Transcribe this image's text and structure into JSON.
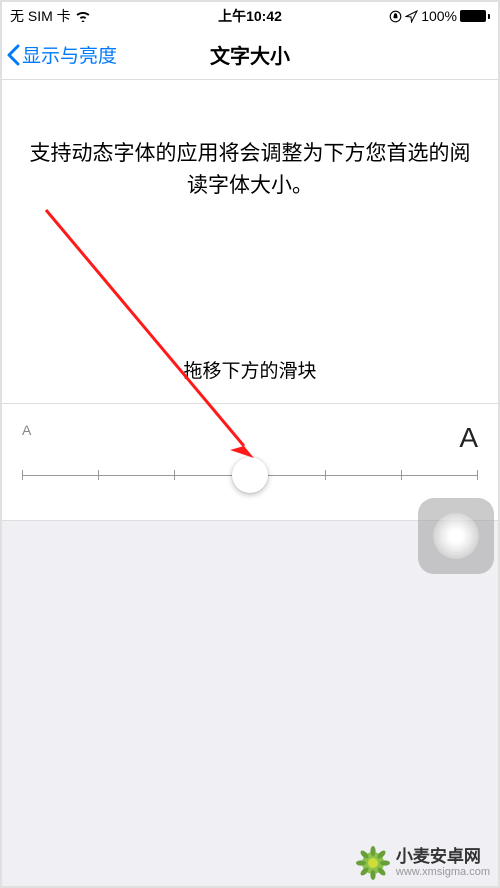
{
  "status": {
    "carrier": "无 SIM 卡",
    "time": "上午10:42",
    "battery_pct": "100%"
  },
  "nav": {
    "back_label": "显示与亮度",
    "title": "文字大小"
  },
  "body": {
    "description": "支持动态字体的应用将会调整为下方您首选的阅读字体大小。",
    "hint": "拖移下方的滑块"
  },
  "slider": {
    "min_label": "A",
    "max_label": "A",
    "steps": 7,
    "value_index": 3
  },
  "watermark": {
    "title": "小麦安卓网",
    "url": "www.xmsigma.com"
  }
}
